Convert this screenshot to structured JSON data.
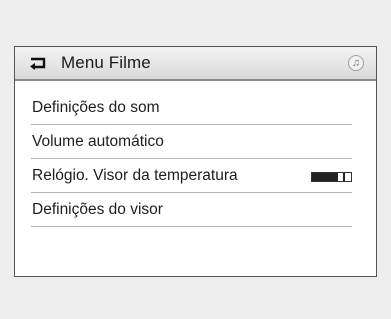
{
  "header": {
    "title": "Menu Filme",
    "back_icon": "back-arrow-icon",
    "note_icon": "music-note-icon",
    "note_glyph": "♫"
  },
  "menu": {
    "items": [
      {
        "label": "Definições do som"
      },
      {
        "label": "Volume automático"
      },
      {
        "label": "Relógio. Visor da temperatura",
        "toggle": {
          "state": "on"
        }
      },
      {
        "label": "Definições do visor"
      }
    ]
  }
}
